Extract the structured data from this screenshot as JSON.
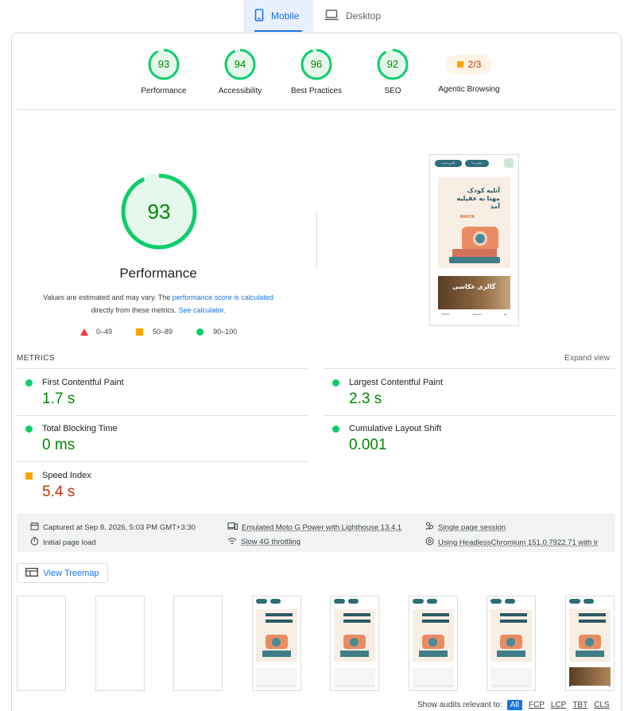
{
  "tabs": [
    {
      "label": "Mobile",
      "icon": "phone-icon",
      "active": true
    },
    {
      "label": "Desktop",
      "icon": "laptop-icon",
      "active": false
    }
  ],
  "categories": [
    {
      "label": "Performance",
      "score": "93",
      "fraction": 0.93,
      "color": "#0cce6b"
    },
    {
      "label": "Accessibility",
      "score": "94",
      "fraction": 0.94,
      "color": "#0cce6b"
    },
    {
      "label": "Best Practices",
      "score": "96",
      "fraction": 0.96,
      "color": "#0cce6b"
    },
    {
      "label": "SEO",
      "score": "92",
      "fraction": 0.92,
      "color": "#0cce6b"
    },
    {
      "label": "Agentic Browsing",
      "score": "2/3",
      "color": "#ffa400"
    }
  ],
  "performance": {
    "score": "93",
    "fraction": 0.93,
    "title": "Performance",
    "desc_1": "Values are estimated and may vary. The ",
    "desc_link_1": "performance score is calculated",
    "desc_2": "directly from these metrics. ",
    "desc_link_2": "See calculator",
    "desc_3": ".",
    "legend": [
      {
        "range": "0–49",
        "shape": "triangle",
        "color": "#ff3333"
      },
      {
        "range": "50–89",
        "shape": "square",
        "color": "#ffa400"
      },
      {
        "range": "90–100",
        "shape": "circle",
        "color": "#0cce6b"
      }
    ]
  },
  "screenshot": {
    "btn_1": "ﺑﺎﻻﺗﺮﯾﻦ ﻗﯿﻤﺖ",
    "btn_2": "ﺗﻤﺎس ﺑﺎ ﻣﺎ",
    "hero_title": "آتلیه کودک مهتا به عقیلیه آمد",
    "hero_brand": "MAHTA",
    "gallery_text": "گالری عکاسی",
    "nav": [
      "MAHTA",
      "ﻣﺤﺼﻮﻻت",
      "ﻣﻨﻮ"
    ]
  },
  "metrics": {
    "title": "METRICS",
    "expand_label": "Expand view",
    "items": [
      {
        "label": "First Contentful Paint",
        "value": "1.7 s",
        "status": "good"
      },
      {
        "label": "Largest Contentful Paint",
        "value": "2.3 s",
        "status": "good"
      },
      {
        "label": "Total Blocking Time",
        "value": "0 ms",
        "status": "good"
      },
      {
        "label": "Cumulative Layout Shift",
        "value": "0.001",
        "status": "good"
      },
      {
        "label": "Speed Index",
        "value": "5.4 s",
        "status": "average"
      }
    ]
  },
  "info": {
    "captured": "Captured at Sep 8, 2026, 5:03 PM GMT+3:30",
    "initial": "Initial page load",
    "device": "Emulated Moto G Power with Lighthouse 13.4.1",
    "throttle": "Slow 4G throttling",
    "session": "Single page session",
    "browser": "Using HeadlessChromium 151.0.7922.71 with lr"
  },
  "treemap_label": "View Treemap",
  "filmstrip": [
    {
      "state": "blank"
    },
    {
      "state": "blank"
    },
    {
      "state": "blank"
    },
    {
      "state": "hero"
    },
    {
      "state": "hero"
    },
    {
      "state": "hero"
    },
    {
      "state": "hero"
    },
    {
      "state": "full"
    }
  ],
  "audits": {
    "label": "Show audits relevant to:",
    "filters": [
      "All",
      "FCP",
      "LCP",
      "TBT",
      "CLS"
    ],
    "active": "All"
  },
  "colors": {
    "pass": "#0cce6b",
    "pass_text": "#008800",
    "average": "#ffa400",
    "average_text": "#c33300",
    "link": "#1a73e8"
  }
}
